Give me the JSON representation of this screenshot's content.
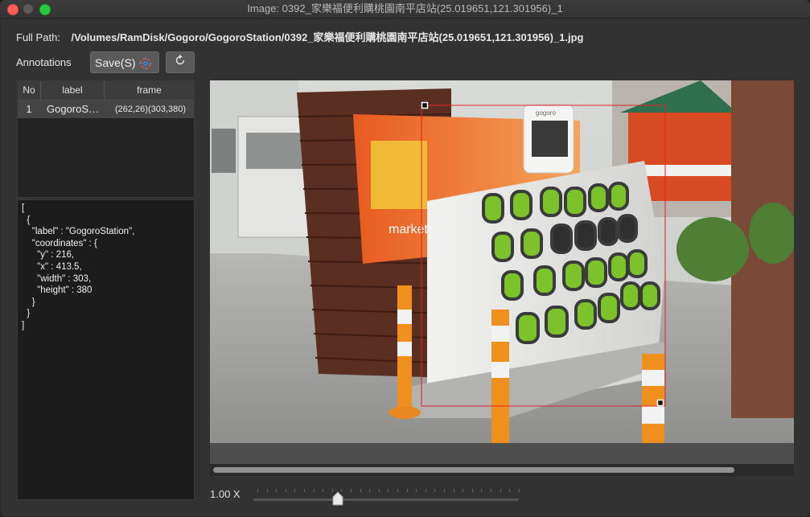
{
  "window": {
    "title": "Image: 0392_家樂福便利購桃園南平店站(25.019651,121.301956)_1"
  },
  "fullpath": {
    "label": "Full Path:",
    "value": "/Volumes/RamDisk/Gogoro/GogoroStation/0392_家樂福便利購桃園南平店站(25.019651,121.301956)_1.jpg"
  },
  "toolbar": {
    "annotations_label": "Annotations",
    "save_label": "Save(S)",
    "save_icon": "target-icon",
    "refresh_icon": "refresh-icon"
  },
  "table": {
    "headers": [
      "No",
      "label",
      "frame"
    ],
    "rows": [
      {
        "no": "1",
        "label": "GogoroStation",
        "frame": "(262,26)(303,380)"
      }
    ]
  },
  "json_text": "[\n  {\n    \"label\" : \"GogoroStation\",\n    \"coordinates\" : {\n      \"y\" : 216,\n      \"x\" : 413.5,\n      \"width\" : 303,\n      \"height\" : 380\n    }\n  }\n]",
  "station_brand": "gogoro",
  "store_sign": "market",
  "zoom": {
    "label": "1.00 X",
    "value": 1.0
  },
  "colors": {
    "window_bg": "#323232",
    "box": "#e0202a",
    "accent_green": "#7cc22b"
  }
}
